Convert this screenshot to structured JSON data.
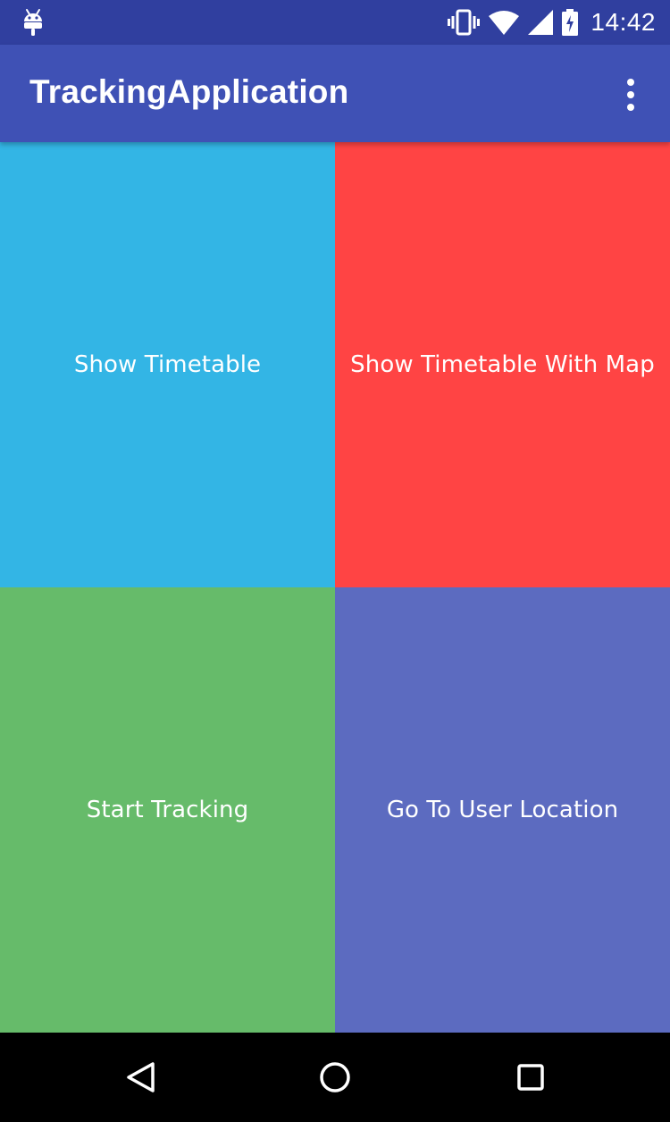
{
  "status_bar": {
    "time": "14:42",
    "icons": [
      "android-notification-icon",
      "vibrate-icon",
      "wifi-icon",
      "signal-icon",
      "battery-charging-icon"
    ]
  },
  "app_bar": {
    "title": "TrackingApplication",
    "menu_icon": "overflow-menu-icon"
  },
  "tiles": [
    {
      "label": "Show Timetable",
      "color": "#33B5E5"
    },
    {
      "label": "Show Timetable With Map",
      "color": "#FF4444"
    },
    {
      "label": "Start Tracking",
      "color": "#66BB6A"
    },
    {
      "label": "Go To User Location",
      "color": "#5C6BC0"
    }
  ],
  "nav_bar": {
    "buttons": [
      "back-icon",
      "home-icon",
      "recents-icon"
    ]
  },
  "colors": {
    "status_bar": "#303F9F",
    "app_bar": "#3F51B5",
    "nav_bar": "#000000"
  }
}
